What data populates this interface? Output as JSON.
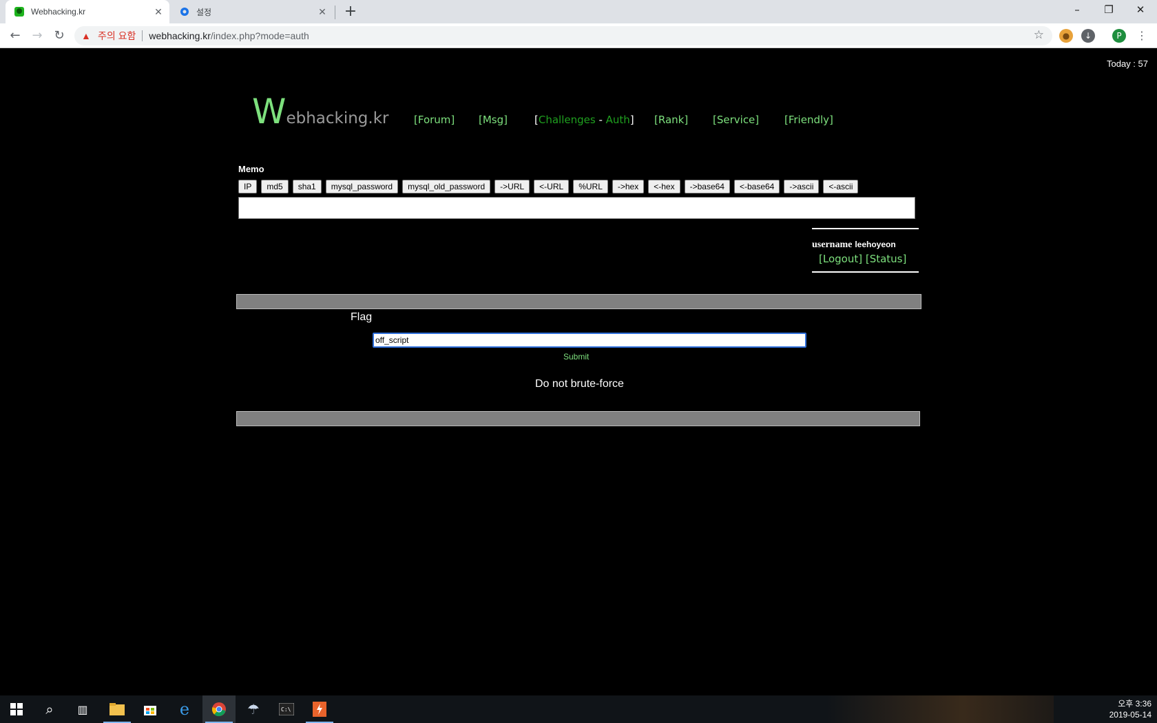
{
  "browser": {
    "tabs": [
      {
        "title": "Webhacking.kr",
        "icon": "webhacking-favicon",
        "active": true
      },
      {
        "title": "설정",
        "icon": "gear-icon",
        "active": false
      }
    ],
    "warning_text": "주의 요함",
    "url_host": "webhacking.kr",
    "url_path": "/index.php?mode=auth",
    "profile_initial": "P"
  },
  "page": {
    "today": "Today : 57",
    "logo": {
      "big_letter": "W",
      "rest": "ebhacking.kr"
    },
    "nav": {
      "forum": "[Forum]",
      "msg": "[Msg]",
      "challenges_open": "[",
      "challenges": "Challenges",
      "dash": " - ",
      "auth": "Auth",
      "challenges_close": "]",
      "rank": "[Rank]",
      "service": "[Service]",
      "friendly": "[Friendly]"
    },
    "memo": {
      "label": "Memo",
      "buttons": [
        "IP",
        "md5",
        "sha1",
        "mysql_password",
        "mysql_old_password",
        "->URL",
        "<-URL",
        "%URL",
        "->hex",
        "<-hex",
        "->base64",
        "<-base64",
        "->ascii",
        "<-ascii"
      ],
      "text": ""
    },
    "user": {
      "label": "username",
      "name": "leehoyeon",
      "logout": "[Logout]",
      "status": "[Status]"
    },
    "auth": {
      "flag_label": "Flag",
      "flag_value": "off_script",
      "submit": "Submit",
      "notice": "Do not brute-force"
    }
  },
  "taskbar": {
    "time": "오후 3:36",
    "date": "2019-05-14"
  }
}
